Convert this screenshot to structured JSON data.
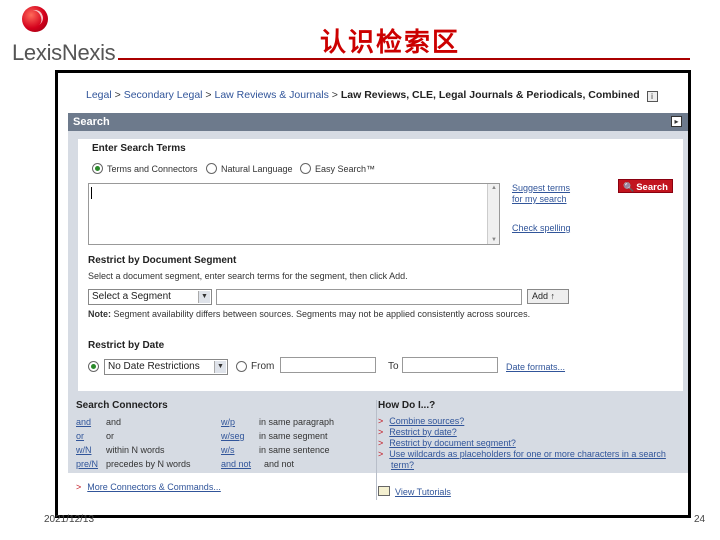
{
  "slide": {
    "logo_text": "LexisNexis",
    "title": "认识检索区",
    "date": "2021/12/13",
    "page_number": "24"
  },
  "breadcrumb": {
    "items": [
      "Legal",
      "Secondary Legal",
      "Law Reviews & Journals"
    ],
    "separator": ">",
    "current": "Law Reviews, CLE, Legal Journals & Periodicals, Combined",
    "info_icon": "i"
  },
  "search_panel": {
    "header": "Search",
    "collapse_icon": "▸",
    "enter_terms_label": "Enter Search Terms",
    "modes": [
      {
        "label": "Terms and Connectors",
        "selected": true
      },
      {
        "label": "Natural Language",
        "selected": false
      },
      {
        "label": "Easy Search™",
        "selected": false
      }
    ],
    "suggest_terms_link": "Suggest terms for my search",
    "check_spelling_link": "Check spelling",
    "search_button": "Search",
    "search_button_icon": "🔍",
    "restrict_segment_label": "Restrict by Document Segment",
    "segment_instruction": "Select a document segment, enter search terms for the segment, then click Add.",
    "segment_select": "Select a Segment",
    "add_button": "Add",
    "note_label": "Note:",
    "note_text": "Segment availability differs between sources. Segments may not be applied consistently across sources.",
    "restrict_date_label": "Restrict by Date",
    "date_select": "No Date Restrictions",
    "from_label": "From",
    "to_label": "To",
    "date_formats_link": "Date formats..."
  },
  "connectors": {
    "title": "Search Connectors",
    "rows": [
      {
        "op1": "and",
        "desc1": "and",
        "op2": "w/p",
        "desc2": "in same paragraph"
      },
      {
        "op1": "or",
        "desc1": "or",
        "op2": "w/seg",
        "desc2": "in same segment"
      },
      {
        "op1": "w/N",
        "desc1": "within N words",
        "op2": "w/s",
        "desc2": "in same sentence"
      },
      {
        "op1": "pre/N",
        "desc1": "precedes by N words",
        "op2": "and not",
        "desc2": "and not"
      }
    ],
    "more_link": "More Connectors & Commands..."
  },
  "how_do_i": {
    "title": "How Do I...?",
    "items": [
      "Combine sources?",
      "Restrict by date?",
      "Restrict by document segment?",
      "Use wildcards as placeholders for one or more characters in a search term?"
    ],
    "tutorials_link": "View Tutorials"
  }
}
